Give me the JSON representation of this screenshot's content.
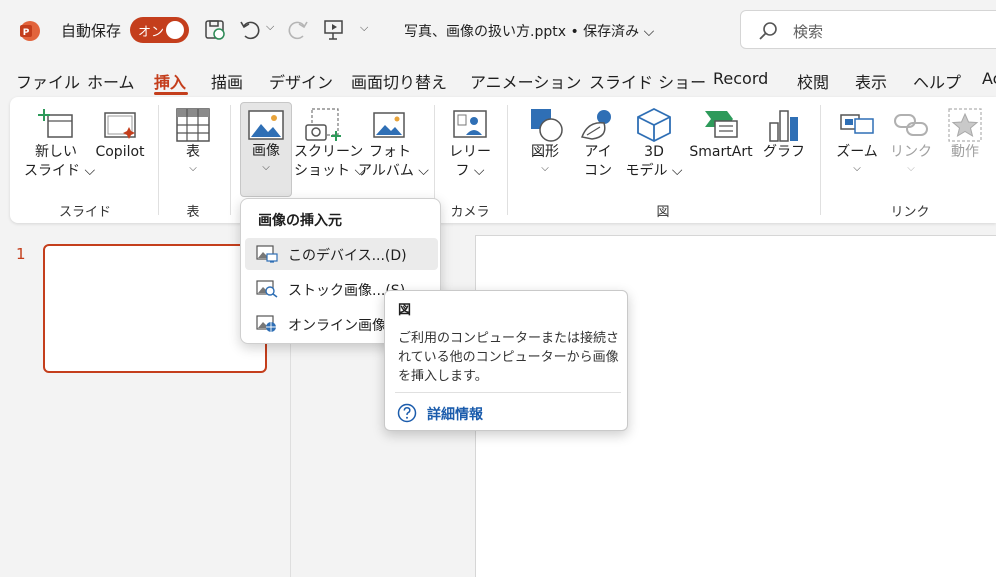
{
  "titlebar": {
    "autosave_label": "自動保存",
    "autosave_state": "オン",
    "document_title": "写真、画像の扱い方.pptx • 保存済み ⌵",
    "search_placeholder": "検索",
    "accent_color": "#c43e1c"
  },
  "tabs": [
    "ファイル",
    "ホーム",
    "挿入",
    "描画",
    "デザイン",
    "画面切り替え",
    "アニメーション",
    "スライド ショー",
    "Record",
    "校閲",
    "表示",
    "ヘルプ",
    "Ac"
  ],
  "active_tab": "挿入",
  "ribbon": {
    "new_slide": "新しい",
    "new_slide_2": "スライド ⌵",
    "copilot": "Copilot",
    "table": "表",
    "image": "画像",
    "screenshot": "スクリーン",
    "screenshot_2": "ショット ⌵",
    "photo_album": "フォト",
    "photo_album_2": "アルバム ⌵",
    "cameo": "レリー",
    "cameo_2": "フ ⌵",
    "shapes": "図形",
    "icons": "アイ",
    "icons_2": "コン",
    "model3d": "3D",
    "model3d_2": "モデル ⌵",
    "smartart": "SmartArt",
    "chart": "グラフ",
    "zoom": "ズーム",
    "link": "リンク",
    "action": "動作",
    "chevron": "⌵",
    "groups": {
      "slides": "スライド",
      "tables": "表",
      "camera": "カメラ",
      "illustrations": "図",
      "links": "リンク"
    }
  },
  "slide_panel": {
    "slide_number": "1"
  },
  "image_menu": {
    "header": "画像の挿入元",
    "items": [
      "このデバイス...(D)",
      "ストック画像...(S)",
      "オンライン画像(O)"
    ]
  },
  "tooltip": {
    "title": "図",
    "body": "ご利用のコンピューターまたは接続されている他のコンピューターから画像を挿入します。",
    "link": "詳細情報"
  }
}
